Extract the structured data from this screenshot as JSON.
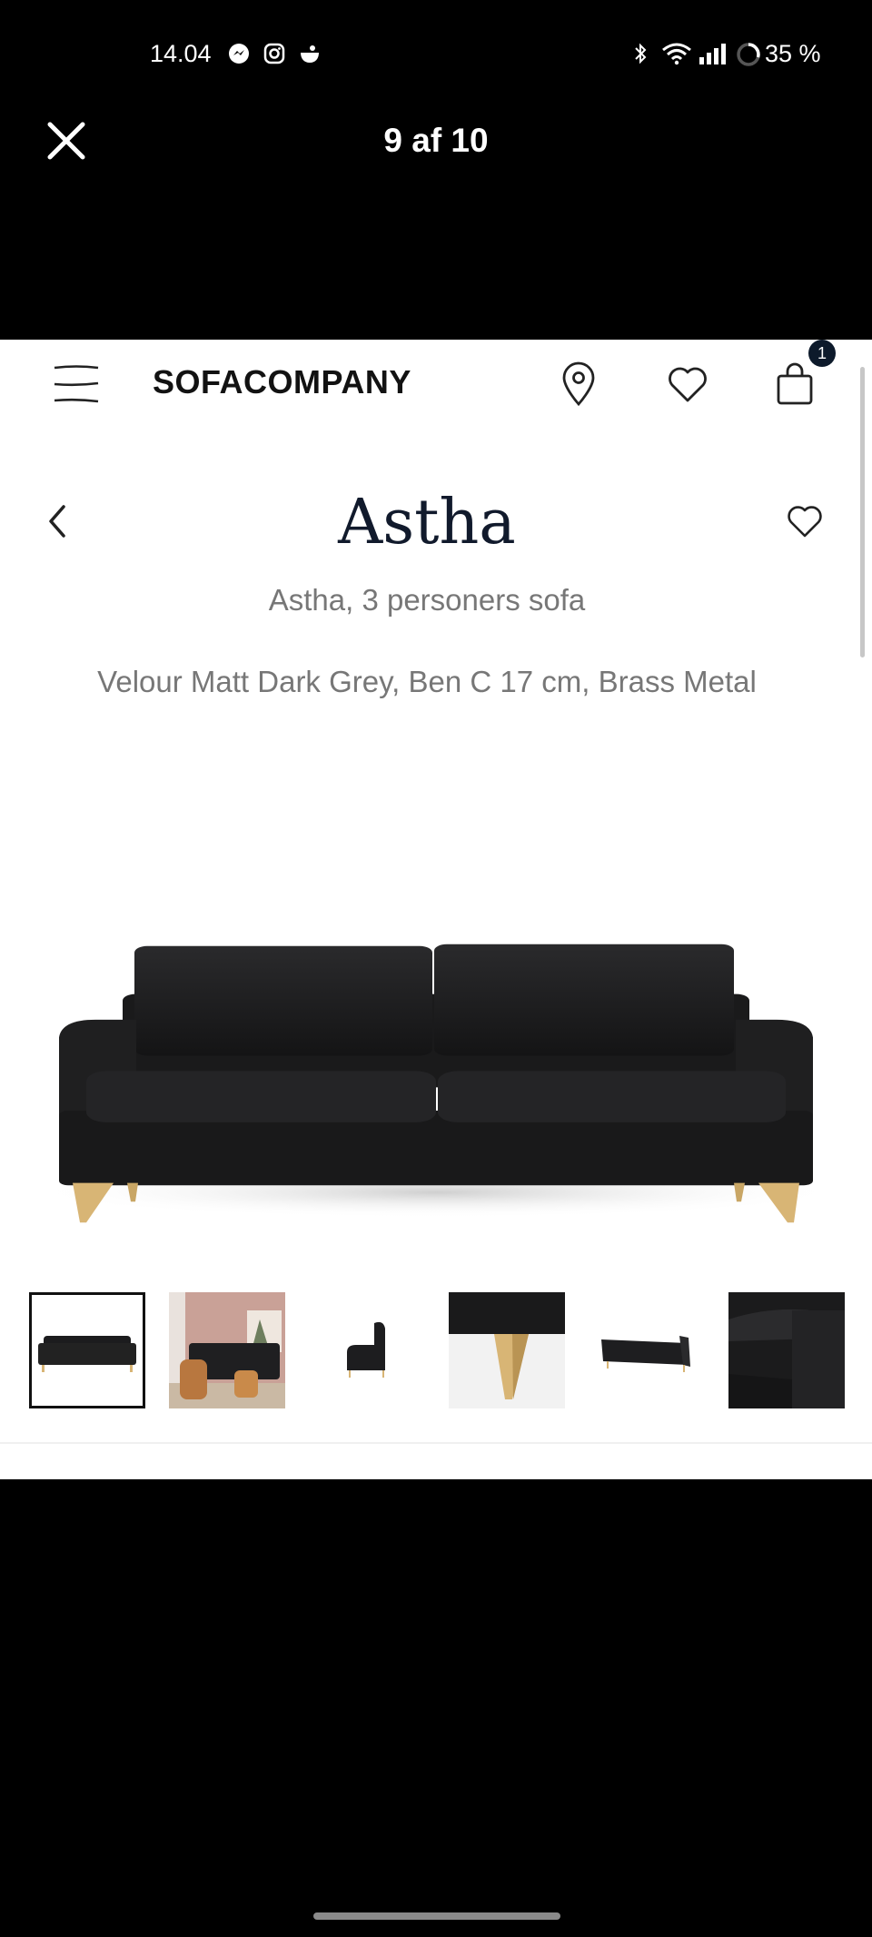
{
  "status_bar": {
    "time": "14.04",
    "battery": "35 %",
    "left_icons": [
      "messenger-icon",
      "instagram-icon",
      "app-icon"
    ],
    "right_icons": [
      "bluetooth-icon",
      "wifi-icon",
      "signal-icon",
      "battery-ring-icon"
    ]
  },
  "viewer": {
    "counter": "9 af 10",
    "close_icon": "close-icon"
  },
  "site": {
    "brand": "SOFACOMPANY",
    "cart_count": "1",
    "icons": [
      "menu-icon",
      "location-pin-icon",
      "heart-icon",
      "shopping-bag-icon"
    ]
  },
  "product": {
    "title": "Astha",
    "subtitle": "Astha, 3 personers sofa",
    "variant": "Velour Matt Dark Grey, Ben C 17 cm, Brass Metal"
  },
  "gallery": {
    "selected_index": 0,
    "thumbnails": [
      "thumb-sofa-front",
      "thumb-living-room",
      "thumb-sofa-side",
      "thumb-leg-closeup",
      "thumb-sofa-angle",
      "thumb-fabric-closeup"
    ]
  },
  "colors": {
    "brand_text": "#121212",
    "badge": "#0d1a2b",
    "muted_text": "#777777",
    "sofa": "#1c1c1e",
    "brass": "#d8b575"
  }
}
